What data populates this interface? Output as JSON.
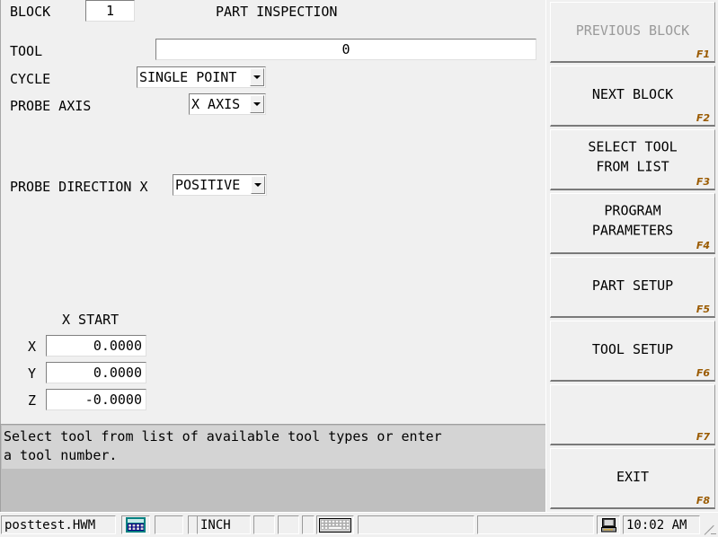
{
  "screen": {
    "title": "PART INSPECTION"
  },
  "form": {
    "block": {
      "label": "BLOCK",
      "value": "1"
    },
    "tool": {
      "label": "TOOL",
      "value": "0"
    },
    "cycle": {
      "label": "CYCLE",
      "value": "SINGLE POINT",
      "options": [
        "SINGLE POINT"
      ]
    },
    "probe_axis": {
      "label": "PROBE AXIS",
      "value": "X AXIS",
      "options": [
        "X AXIS"
      ]
    },
    "probe_direction": {
      "label": "PROBE DIRECTION X",
      "value": "POSITIVE",
      "options": [
        "POSITIVE"
      ]
    },
    "start_group": {
      "heading": "X START",
      "rows": [
        {
          "axis": "X",
          "value": "0.0000"
        },
        {
          "axis": "Y",
          "value": "0.0000"
        },
        {
          "axis": "Z",
          "value": "-0.0000"
        }
      ]
    }
  },
  "message": {
    "line1": "Select tool from list of available tool types or enter",
    "line2": "a tool number."
  },
  "fkeys": [
    {
      "label": "PREVIOUS BLOCK",
      "key": "F1",
      "disabled": true
    },
    {
      "label": "NEXT BLOCK",
      "key": "F2",
      "disabled": false
    },
    {
      "label": "SELECT TOOL\nFROM LIST",
      "key": "F3",
      "disabled": false
    },
    {
      "label": "PROGRAM\nPARAMETERS",
      "key": "F4",
      "disabled": false
    },
    {
      "label": "PART SETUP",
      "key": "F5",
      "disabled": false
    },
    {
      "label": "TOOL SETUP",
      "key": "F6",
      "disabled": false
    },
    {
      "label": "",
      "key": "F7",
      "disabled": false
    },
    {
      "label": "EXIT",
      "key": "F8",
      "disabled": false
    }
  ],
  "statusbar": {
    "filename": "posttest.HWM",
    "calculator_icon": "calculator-icon",
    "slot_2": "",
    "slot_3": "",
    "units": "INCH",
    "slot_5": "",
    "slot_6": "",
    "slot_7": "",
    "keyboard_icon": "keyboard-icon",
    "slot_9": "",
    "slot_10": "",
    "computer_icon": "computer-icon",
    "time": "10:02 AM"
  },
  "colors": {
    "background": "#f0f0f0",
    "field_background": "#ffffff",
    "message_background": "#d4d4d4",
    "message_panel": "#bfbfbf",
    "fkey_label": "#9a5a00",
    "disabled_text": "#9a9a9a",
    "calculator_icon_teal": "#008080",
    "calculator_icon_navy": "#000080"
  }
}
